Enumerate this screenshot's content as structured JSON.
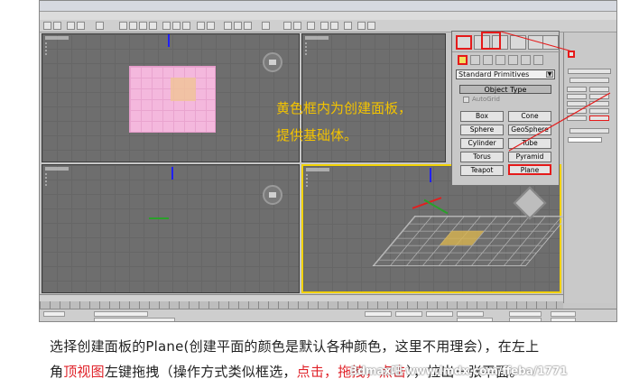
{
  "create_panel": {
    "dropdown_value": "Standard Primitives",
    "rollout_title": "Object Type",
    "autogrid_label": "AutoGrid",
    "buttons": [
      "Box",
      "Cone",
      "Sphere",
      "GeoSphere",
      "Cylinder",
      "Tube",
      "Torus",
      "Pyramid",
      "Teapot",
      "Plane"
    ]
  },
  "overlay": {
    "line1": "黄色框内为创建面板，",
    "line2": "提供基础体。"
  },
  "caption": {
    "line1": "选择创建面板的Plane(创建平面的颜色是默认各种颜色，这里不用理会），在左上",
    "line2_part1": "角",
    "line2_red1": "顶视图",
    "line2_part2": "左键拖拽（操作方式类似框选，",
    "line2_red2": "点击，拖拽，点击",
    "line2_part3": "），拉出一张平面。"
  },
  "watermark": "3dmax吧 www.lmdx.com/ffeba/1771",
  "colors": {
    "highlight_yellow": "#f2d200",
    "annotation_red": "#e51a1a",
    "caption_red": "#e0242b",
    "plane_pink": "#f4b8dd"
  }
}
